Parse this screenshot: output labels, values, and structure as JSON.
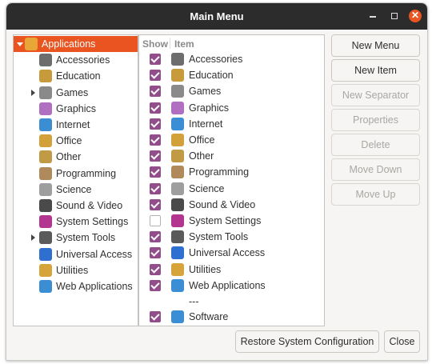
{
  "window": {
    "title": "Main Menu"
  },
  "columns": {
    "show": "Show",
    "item": "Item"
  },
  "tree": [
    {
      "label": "Applications",
      "icon": "applications-folder-icon",
      "expander": "open",
      "selected": true,
      "color": "#e8a637"
    },
    {
      "label": "Accessories",
      "icon": "accessories-icon",
      "color": "#6d6d6d"
    },
    {
      "label": "Education",
      "icon": "education-icon",
      "color": "#c79a3c"
    },
    {
      "label": "Games",
      "icon": "games-icon",
      "expander": "closed",
      "color": "#8a8a8a"
    },
    {
      "label": "Graphics",
      "icon": "graphics-icon",
      "color": "#b06fc0"
    },
    {
      "label": "Internet",
      "icon": "internet-globe-icon",
      "color": "#3b8ed4"
    },
    {
      "label": "Office",
      "icon": "office-icon",
      "color": "#d2a13a"
    },
    {
      "label": "Other",
      "icon": "other-icon",
      "color": "#c19a45"
    },
    {
      "label": "Programming",
      "icon": "programming-icon",
      "color": "#b08a5a"
    },
    {
      "label": "Science",
      "icon": "science-flask-icon",
      "color": "#9e9e9e"
    },
    {
      "label": "Sound & Video",
      "icon": "sound-video-icon",
      "color": "#4a4a4a"
    },
    {
      "label": "System Settings",
      "icon": "system-settings-icon",
      "color": "#b3358f"
    },
    {
      "label": "System Tools",
      "icon": "system-tools-icon",
      "expander": "closed",
      "color": "#5a5a5a"
    },
    {
      "label": "Universal Access",
      "icon": "universal-access-icon",
      "color": "#2f6fd0"
    },
    {
      "label": "Utilities",
      "icon": "utilities-icon",
      "color": "#d6a43b"
    },
    {
      "label": "Web Applications",
      "icon": "web-applications-icon",
      "color": "#3b8ed4"
    }
  ],
  "items": [
    {
      "label": "Accessories",
      "show": true,
      "icon": "accessories-icon",
      "color": "#6d6d6d"
    },
    {
      "label": "Education",
      "show": true,
      "icon": "education-icon",
      "color": "#c79a3c"
    },
    {
      "label": "Games",
      "show": true,
      "icon": "games-icon",
      "color": "#8a8a8a"
    },
    {
      "label": "Graphics",
      "show": true,
      "icon": "graphics-icon",
      "color": "#b06fc0"
    },
    {
      "label": "Internet",
      "show": true,
      "icon": "internet-globe-icon",
      "color": "#3b8ed4"
    },
    {
      "label": "Office",
      "show": true,
      "icon": "office-icon",
      "color": "#d2a13a"
    },
    {
      "label": "Other",
      "show": true,
      "icon": "other-icon",
      "color": "#c19a45"
    },
    {
      "label": "Programming",
      "show": true,
      "icon": "programming-icon",
      "color": "#b08a5a"
    },
    {
      "label": "Science",
      "show": true,
      "icon": "science-flask-icon",
      "color": "#9e9e9e"
    },
    {
      "label": "Sound & Video",
      "show": true,
      "icon": "sound-video-icon",
      "color": "#4a4a4a"
    },
    {
      "label": "System Settings",
      "show": false,
      "icon": "system-settings-icon",
      "color": "#b3358f"
    },
    {
      "label": "System Tools",
      "show": true,
      "icon": "system-tools-icon",
      "color": "#5a5a5a"
    },
    {
      "label": "Universal Access",
      "show": true,
      "icon": "universal-access-icon",
      "color": "#2f6fd0"
    },
    {
      "label": "Utilities",
      "show": true,
      "icon": "utilities-icon",
      "color": "#d6a43b"
    },
    {
      "label": "Web Applications",
      "show": true,
      "icon": "web-applications-icon",
      "color": "#3b8ed4"
    }
  ],
  "separator_label": "---",
  "software_item": {
    "label": "Software",
    "show": true,
    "icon": "software-icon",
    "color": "#3b8ed4"
  },
  "buttons": {
    "new_menu": "New Menu",
    "new_item": "New Item",
    "new_separator": "New Separator",
    "properties": "Properties",
    "delete": "Delete",
    "move_down": "Move Down",
    "move_up": "Move Up",
    "restore": "Restore System Configuration",
    "close": "Close"
  },
  "colors": {
    "accent": "#e95420",
    "checkbox": "#924d8b",
    "titlebar": "#2c2c2c"
  }
}
